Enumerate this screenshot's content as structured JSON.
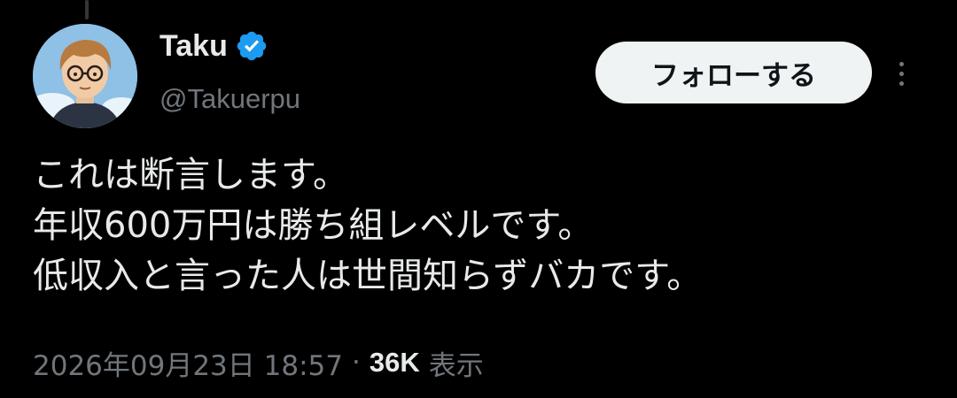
{
  "author": {
    "display_name": "Taku",
    "handle": "@Takuerpu",
    "verified": true
  },
  "header": {
    "follow_label": "フォローする"
  },
  "tweet": {
    "lines": [
      "これは断言します。",
      "年収600万円は勝ち組レベルです。",
      "低収入と言った人は世間知らずバカです。"
    ]
  },
  "meta": {
    "timestamp": "2026年09月23日 18:57",
    "separator": "·",
    "view_count": "36K",
    "views_label": "表示"
  },
  "colors": {
    "background": "#000000",
    "primary_text": "#e7e9ea",
    "secondary_text": "#71767b",
    "verified_blue": "#1d9bf0",
    "follow_button_bg": "#eff3f4",
    "follow_button_text": "#0f1419"
  },
  "icons": {
    "verified": "verified-badge-icon",
    "more": "more-options-icon"
  }
}
